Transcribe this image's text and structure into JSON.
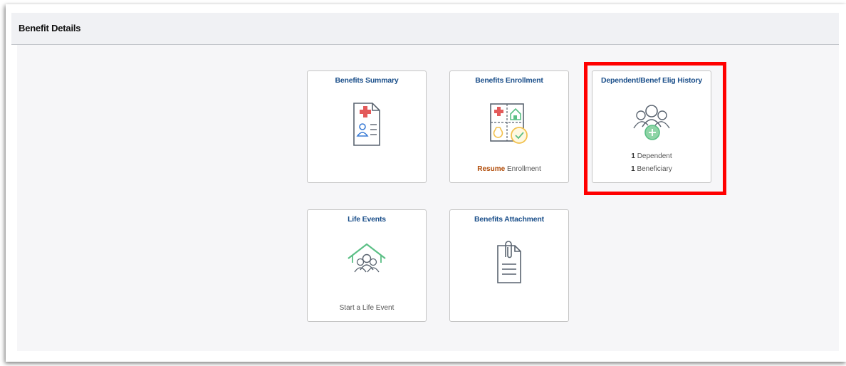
{
  "header": {
    "title": "Benefit Details"
  },
  "tiles": {
    "benefits_summary": {
      "title": "Benefits Summary",
      "icon": "document-medical-icon"
    },
    "benefits_enrollment": {
      "title": "Benefits Enrollment",
      "icon": "enrollment-checklist-icon",
      "footer_action": "Resume",
      "footer_text": "Enrollment"
    },
    "dependent_history": {
      "title": "Dependent/Benef Elig History",
      "icon": "people-add-icon",
      "dependent_count": "1",
      "dependent_label": "Dependent",
      "beneficiary_count": "1",
      "beneficiary_label": "Beneficiary"
    },
    "life_events": {
      "title": "Life Events",
      "icon": "house-family-icon",
      "footer_text": "Start a Life Event"
    },
    "benefits_attachment": {
      "title": "Benefits Attachment",
      "icon": "paperclip-document-icon"
    }
  },
  "colors": {
    "tile_title": "#1b4f8a",
    "highlight": "#ff0000",
    "resume": "#b04a06",
    "icon_green": "#5bbf85",
    "icon_red": "#e35a5a",
    "icon_yellow": "#f2c14e"
  }
}
